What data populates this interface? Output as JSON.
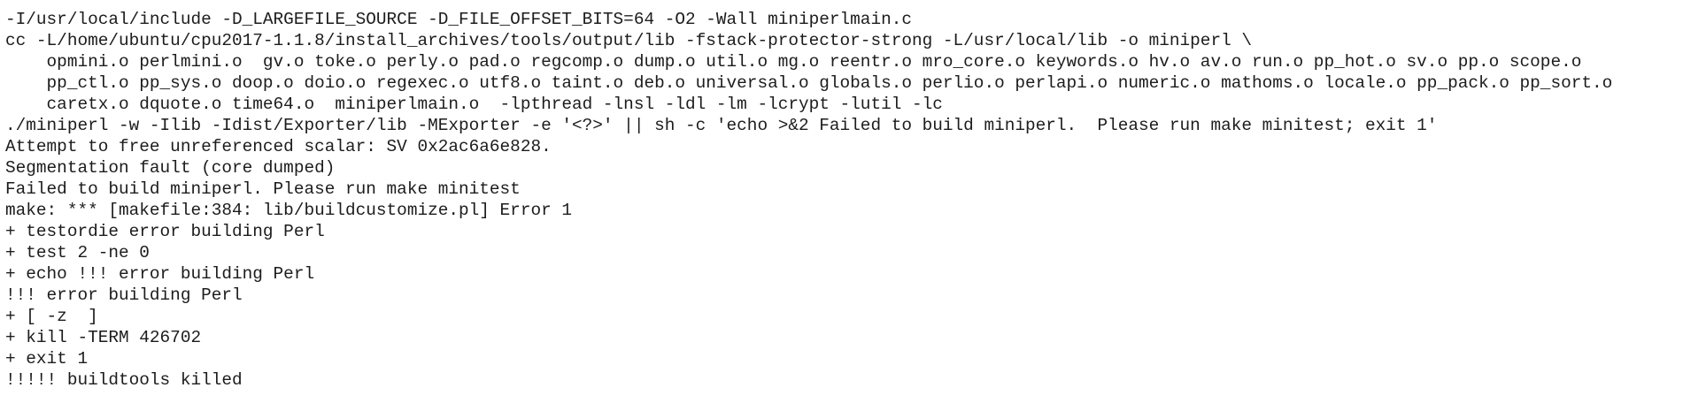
{
  "terminal": {
    "lines": [
      "-I/usr/local/include -D_LARGEFILE_SOURCE -D_FILE_OFFSET_BITS=64 -O2 -Wall miniperlmain.c",
      "cc -L/home/ubuntu/cpu2017-1.1.8/install_archives/tools/output/lib -fstack-protector-strong -L/usr/local/lib -o miniperl \\",
      "    opmini.o perlmini.o  gv.o toke.o perly.o pad.o regcomp.o dump.o util.o mg.o reentr.o mro_core.o keywords.o hv.o av.o run.o pp_hot.o sv.o pp.o scope.o",
      "    pp_ctl.o pp_sys.o doop.o doio.o regexec.o utf8.o taint.o deb.o universal.o globals.o perlio.o perlapi.o numeric.o mathoms.o locale.o pp_pack.o pp_sort.o",
      "    caretx.o dquote.o time64.o  miniperlmain.o  -lpthread -lnsl -ldl -lm -lcrypt -lutil -lc",
      "./miniperl -w -Ilib -Idist/Exporter/lib -MExporter -e '<?>' || sh -c 'echo >&2 Failed to build miniperl.  Please run make minitest; exit 1'",
      "Attempt to free unreferenced scalar: SV 0x2ac6a6e828.",
      "Segmentation fault (core dumped)",
      "Failed to build miniperl. Please run make minitest",
      "make: *** [makefile:384: lib/buildcustomize.pl] Error 1",
      "+ testordie error building Perl",
      "+ test 2 -ne 0",
      "+ echo !!! error building Perl",
      "!!! error building Perl",
      "+ [ -z  ]",
      "+ kill -TERM 426702",
      "+ exit 1",
      "!!!!! buildtools killed"
    ]
  }
}
